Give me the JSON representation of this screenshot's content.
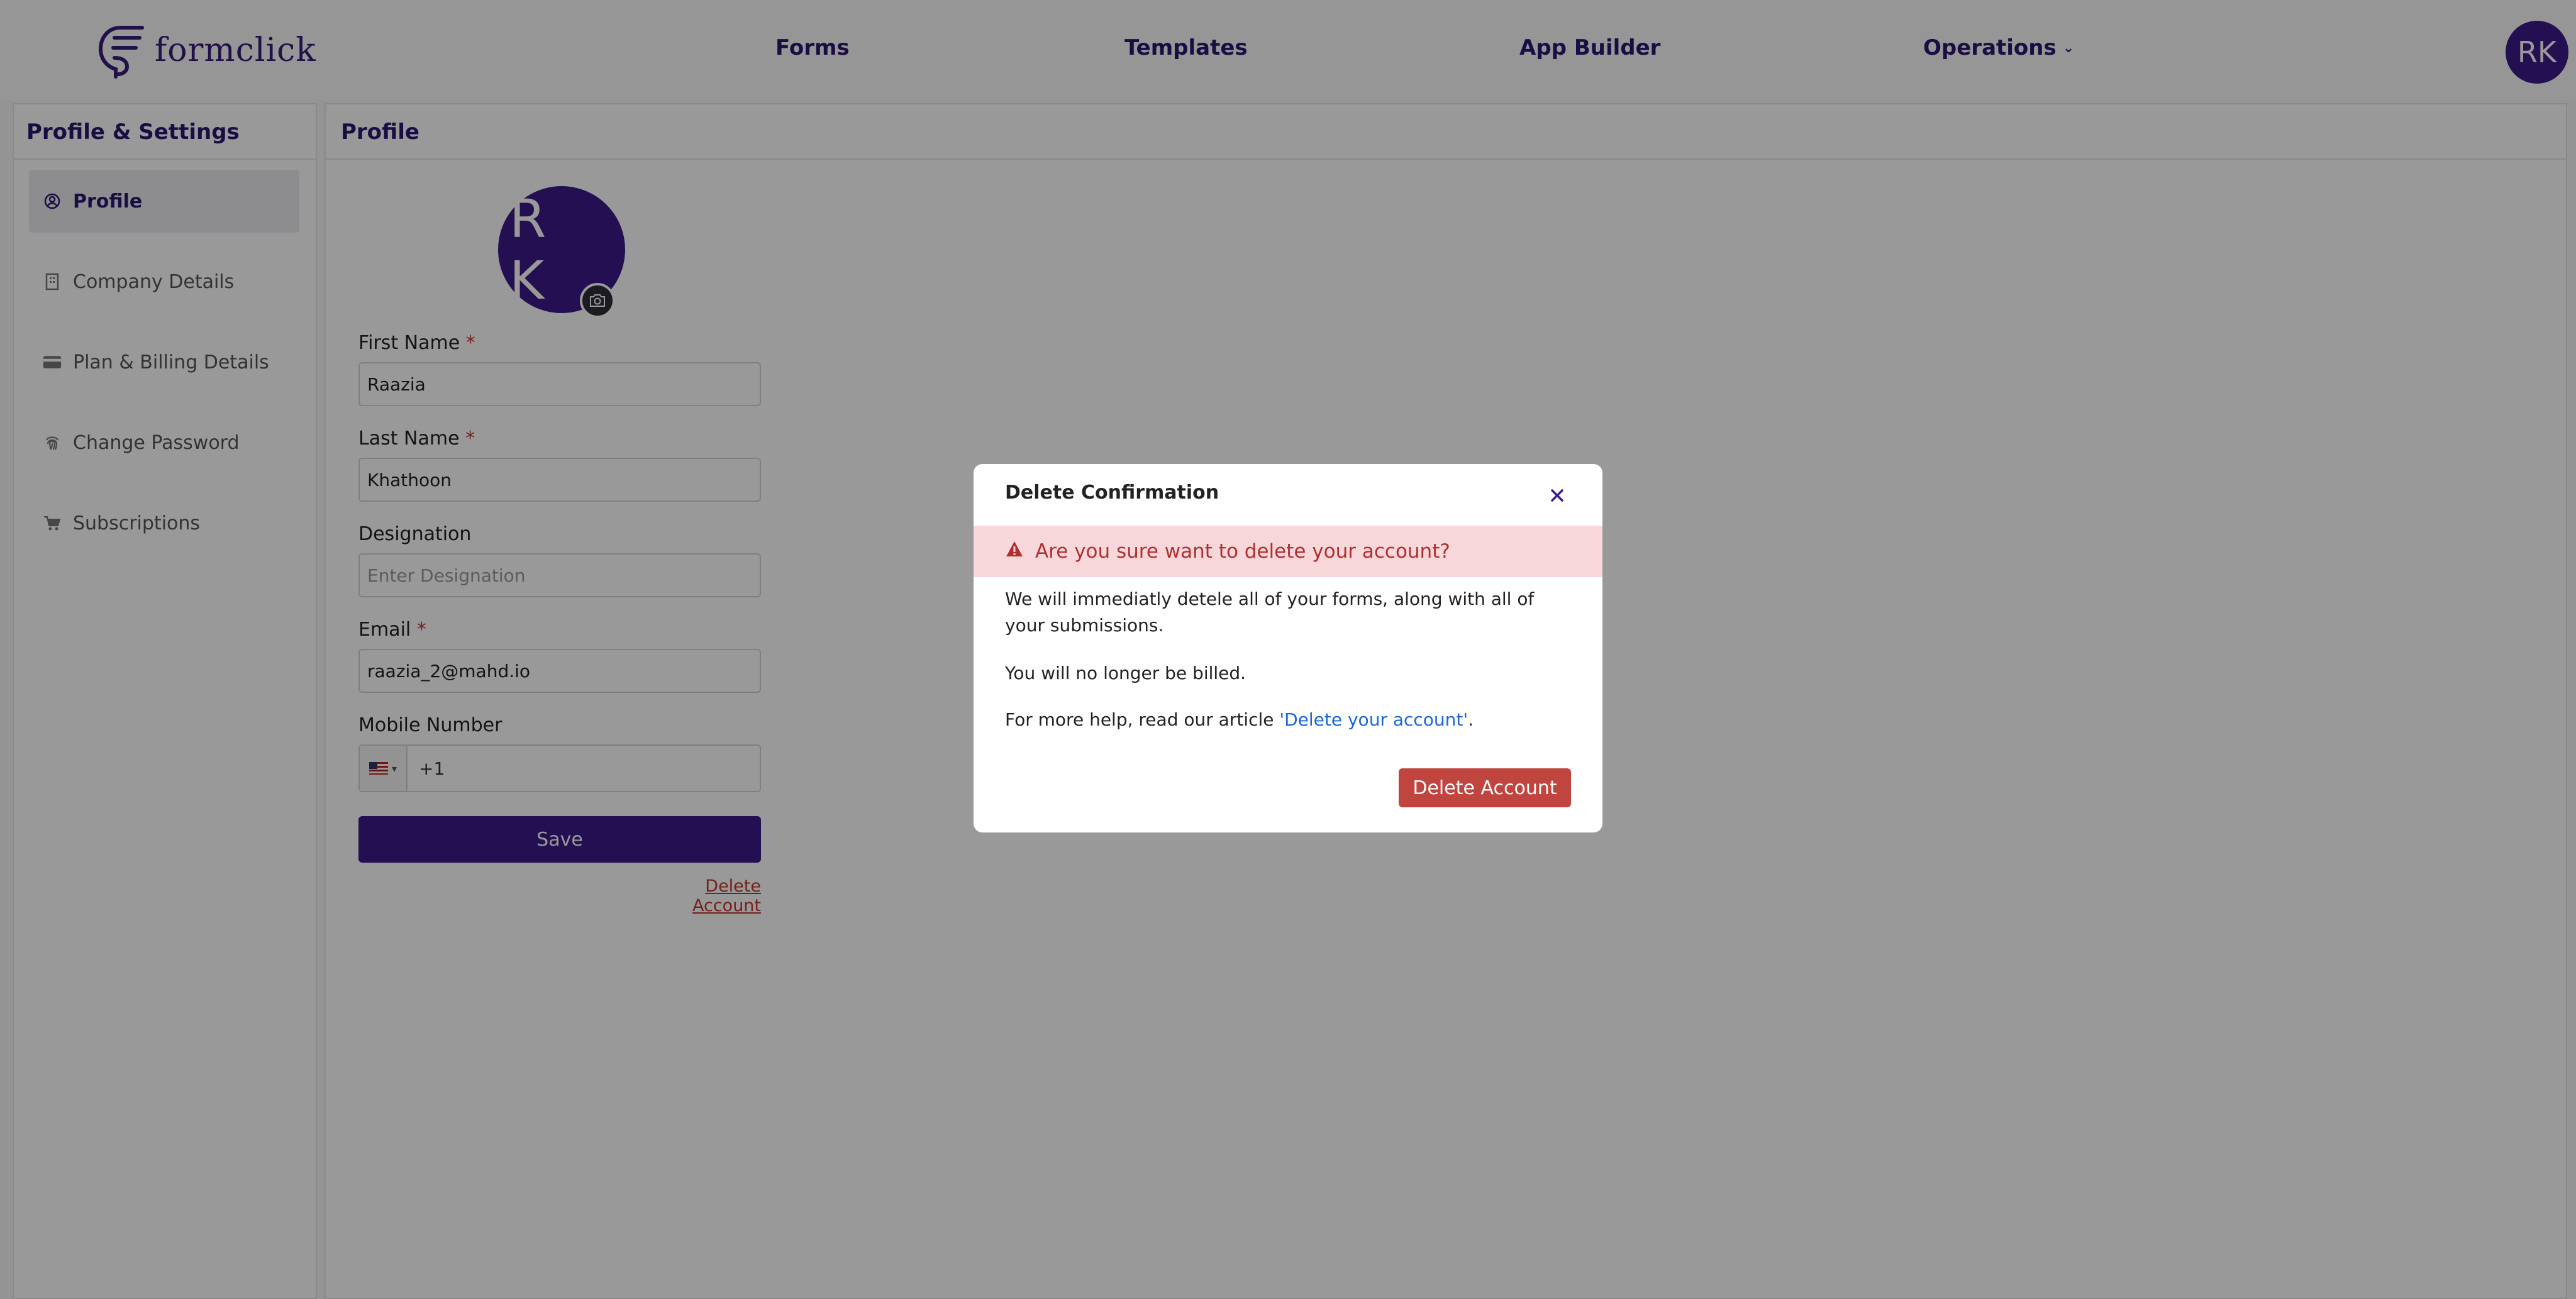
{
  "header": {
    "logo_text": "formclick",
    "nav": {
      "forms": "Forms",
      "templates": "Templates",
      "app_builder": "App Builder",
      "operations": "Operations"
    },
    "avatar_initials": "RK"
  },
  "sidebar": {
    "title": "Profile & Settings",
    "items": [
      {
        "label": "Profile",
        "icon": "user-circle-icon"
      },
      {
        "label": "Company Details",
        "icon": "building-icon"
      },
      {
        "label": "Plan & Billing Details",
        "icon": "credit-card-icon"
      },
      {
        "label": "Change Password",
        "icon": "fingerprint-icon"
      },
      {
        "label": "Subscriptions",
        "icon": "cart-icon"
      }
    ]
  },
  "main": {
    "title": "Profile",
    "avatar_initials": "R K",
    "fields": {
      "first_name_label": "First Name",
      "first_name_value": "Raazia",
      "last_name_label": "Last Name",
      "last_name_value": "Khathoon",
      "designation_label": "Designation",
      "designation_placeholder": "Enter Designation",
      "email_label": "Email",
      "email_value": "raazia_2@mahd.io",
      "mobile_label": "Mobile Number",
      "mobile_value": "+1",
      "required_mark": "*"
    },
    "save_label": "Save",
    "delete_link": "Delete Account"
  },
  "modal": {
    "title": "Delete Confirmation",
    "alert": "Are you sure want to delete your account?",
    "line1": "We will immediatly detele all of your forms, along with all of your submissions.",
    "line2": "You will no longer be billed.",
    "line3_prefix": "For more help, read our article ",
    "line3_link": "'Delete your account'",
    "line3_suffix": ".",
    "delete_button": "Delete Account"
  },
  "colors": {
    "brand": "#3c1a8a",
    "danger": "#c0453f",
    "alert_bg": "#f8d7da",
    "link": "#1a66d6"
  }
}
